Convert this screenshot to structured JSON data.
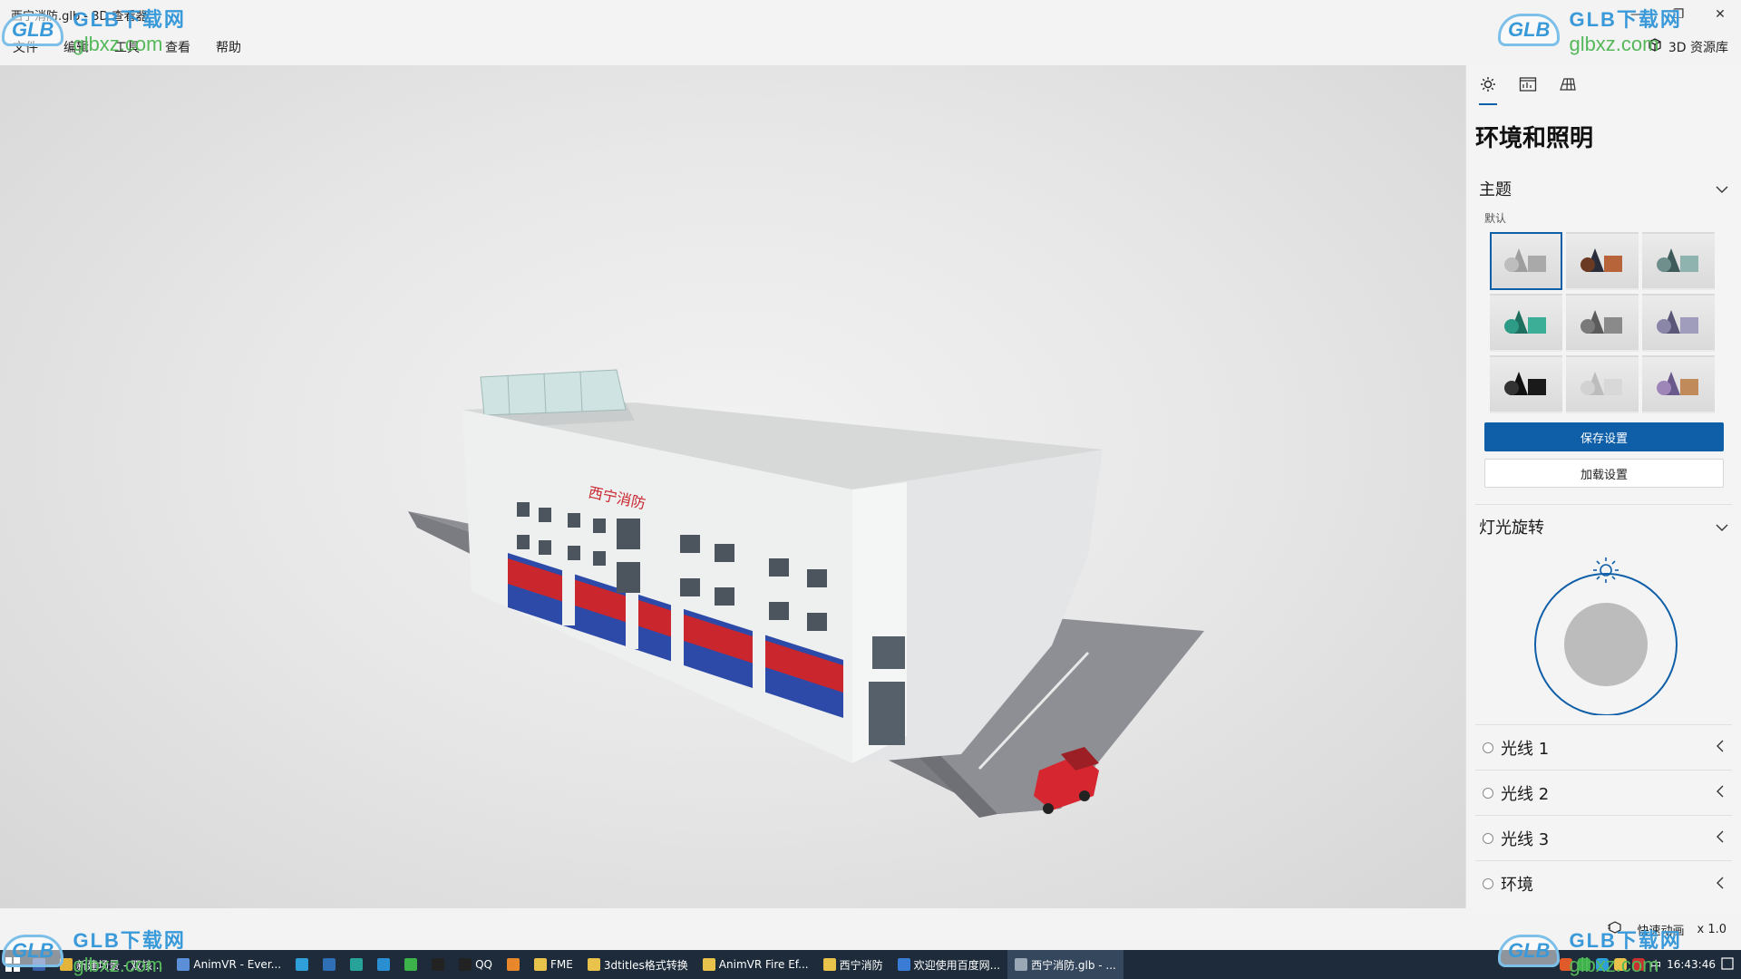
{
  "window": {
    "title": "西宁消防.glb - 3D 查看器",
    "minimize_glyph": "—",
    "maximize_glyph": "❐",
    "close_glyph": "✕"
  },
  "menu": {
    "items": [
      "文件",
      "编辑",
      "工具",
      "查看",
      "帮助"
    ],
    "resource_library": "3D 资源库"
  },
  "viewport": {
    "sign_text": "西宁消防"
  },
  "panel": {
    "tabs": [
      "sun-icon",
      "stats-icon",
      "grid-icon"
    ],
    "heading": "环境和照明",
    "theme": {
      "label": "主题",
      "sub_label": "默认",
      "selected_index": 0,
      "swatches": [
        {
          "sphere": "#bdbdbd",
          "cone": "#9e9e9e",
          "box": "#a9a9a9"
        },
        {
          "sphere": "#6b3a22",
          "cone": "#2a2d3a",
          "box": "#b8643a"
        },
        {
          "sphere": "#6f8f8c",
          "cone": "#3e5a5a",
          "box": "#8fb3ae"
        },
        {
          "sphere": "#2d9b86",
          "cone": "#1f6f61",
          "box": "#3cae98"
        },
        {
          "sphere": "#7a7a7a",
          "cone": "#5b5b5b",
          "box": "#8a8a8a"
        },
        {
          "sphere": "#8a86a8",
          "cone": "#5a5778",
          "box": "#a09cbc"
        },
        {
          "sphere": "#333333",
          "cone": "#111111",
          "box": "#1a1a1a"
        },
        {
          "sphere": "#d2d2d2",
          "cone": "#bcbcbc",
          "box": "#d8d8d8"
        },
        {
          "sphere": "#9e86b8",
          "cone": "#6a5a8c",
          "box": "#c08a5a"
        }
      ]
    },
    "save_button": "保存设置",
    "load_button": "加载设置",
    "light_rotation": "灯光旋转",
    "lights": [
      "光线 1",
      "光线 2",
      "光线 3",
      "环境"
    ]
  },
  "status": {
    "quick_animation": "快速动画",
    "speed": "x 1.0"
  },
  "taskbar": {
    "items": [
      {
        "label": "新建场景 - 双核...",
        "icon": "chrome-icon",
        "color": "#e4b33a"
      },
      {
        "label": "AnimVR - Ever...",
        "icon": "app-icon",
        "color": "#5b8fd8"
      },
      {
        "label": "",
        "icon": "edge-icon",
        "color": "#2e9fd8"
      },
      {
        "label": "",
        "icon": "app-icon",
        "color": "#2f6fb5"
      },
      {
        "label": "",
        "icon": "app-icon",
        "color": "#27a39a"
      },
      {
        "label": "",
        "icon": "app-icon",
        "color": "#2a8fd0"
      },
      {
        "label": "",
        "icon": "wechat-icon",
        "color": "#3cb34a"
      },
      {
        "label": "",
        "icon": "qq-icon",
        "color": "#222222"
      },
      {
        "label": "QQ",
        "icon": "qq-icon",
        "color": "#222222"
      },
      {
        "label": "",
        "icon": "blender-icon",
        "color": "#e8872c"
      },
      {
        "label": "FME",
        "icon": "folder-icon",
        "color": "#e8c24a"
      },
      {
        "label": "3dtitles格式转换",
        "icon": "folder-icon",
        "color": "#e8c24a"
      },
      {
        "label": "AnimVR Fire Ef...",
        "icon": "folder-icon",
        "color": "#e8c24a"
      },
      {
        "label": "西宁消防",
        "icon": "folder-icon",
        "color": "#e8c24a"
      },
      {
        "label": "欢迎使用百度网...",
        "icon": "baidu-icon",
        "color": "#3a7bd5"
      },
      {
        "label": "西宁消防.glb - ...",
        "icon": "viewer-icon",
        "color": "#9aa7b5"
      }
    ],
    "tray_time": "16:43:46",
    "tray_lang": "中"
  },
  "watermark": {
    "logo": "GLB",
    "cn": "GLB下载网",
    "url": "glbxz.com"
  }
}
